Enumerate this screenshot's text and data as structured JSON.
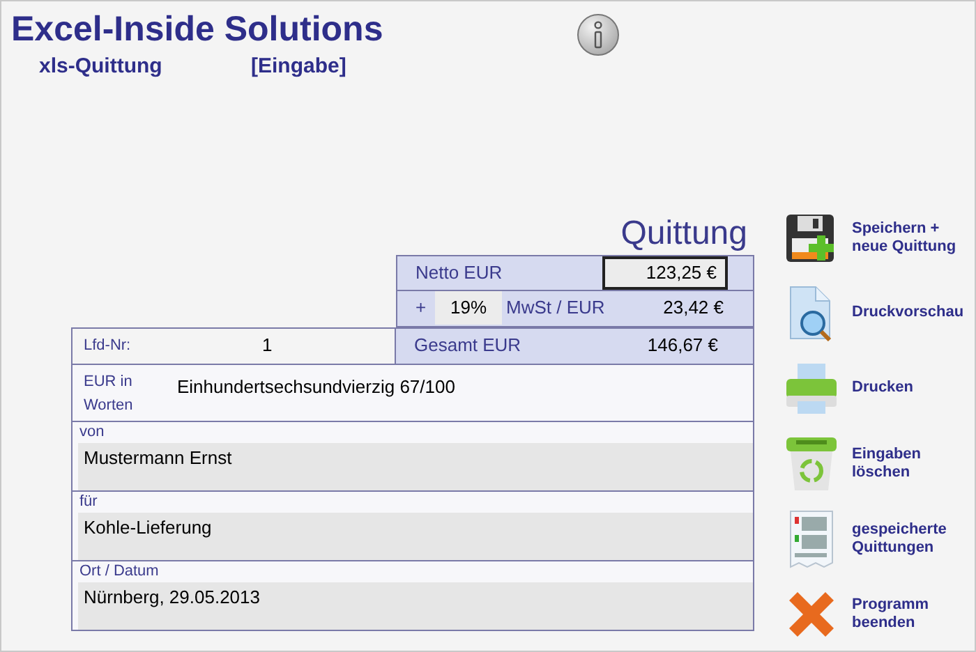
{
  "header": {
    "title": "Excel-Inside Solutions",
    "subtitle": "xls-Quittung",
    "mode": "[Eingabe]"
  },
  "receipt": {
    "title": "Quittung",
    "netto": {
      "label": "Netto EUR",
      "value": "123,25 €",
      "selected": true
    },
    "vat": {
      "prefix": "+",
      "rate": "19%",
      "label": "MwSt / EUR",
      "value": "23,42 €"
    },
    "number": {
      "label": "Lfd-Nr:",
      "value": "1"
    },
    "total": {
      "label": "Gesamt EUR",
      "value": "146,67 €"
    },
    "words": {
      "label_lines": [
        "EUR in",
        "Worten"
      ],
      "value": "Einhundertsechsundvierzig 67/100"
    },
    "fields": [
      {
        "label": "von",
        "value": "Mustermann Ernst"
      },
      {
        "label": "für",
        "value": "Kohle-Lieferung"
      },
      {
        "label": "Ort / Datum",
        "value": "Nürnberg, 29.05.2013"
      }
    ]
  },
  "actions": [
    {
      "kind": "save",
      "label_lines": [
        "Speichern +",
        "neue Quittung"
      ]
    },
    {
      "kind": "preview",
      "label_lines": [
        "Druckvorschau"
      ]
    },
    {
      "kind": "print",
      "label_lines": [
        "Drucken"
      ]
    },
    {
      "kind": "clear",
      "label_lines": [
        "Eingaben",
        "löschen"
      ]
    },
    {
      "kind": "saved",
      "label_lines": [
        "gespeicherte",
        "Quittungen"
      ]
    },
    {
      "kind": "exit",
      "label_lines": [
        "Programm",
        "beenden"
      ]
    }
  ]
}
